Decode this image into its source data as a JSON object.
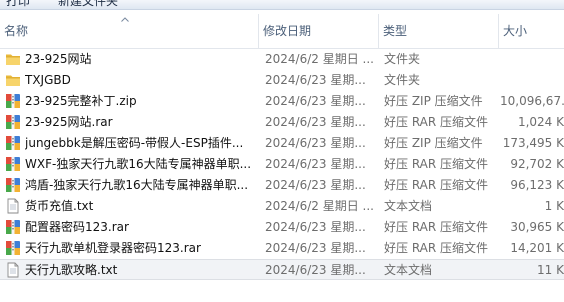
{
  "toolbar": {
    "print_label": "打印",
    "new_folder_label": "新建文件夹"
  },
  "columns": {
    "name": "名称",
    "date": "修改日期",
    "type": "类型",
    "size": "大小"
  },
  "files": [
    {
      "name": "23-925网站",
      "date": "2024/6/2 星期日 ...",
      "type": "文件夹",
      "size": "",
      "icon": "folder-icon"
    },
    {
      "name": "TXJGBD",
      "date": "2024/6/23 星期...",
      "type": "文件夹",
      "size": "",
      "icon": "folder-icon"
    },
    {
      "name": "23-925完整补丁.zip",
      "date": "2024/6/23 星期...",
      "type": "好压 ZIP 压缩文件",
      "size": "10,096,67...",
      "icon": "archive-icon"
    },
    {
      "name": "23-925网站.rar",
      "date": "2024/6/23 星期...",
      "type": "好压 RAR 压缩文件",
      "size": "1,024 K",
      "icon": "archive-icon"
    },
    {
      "name": "jungebbk是解压密码-带假人-ESP插件...",
      "date": "2024/6/23 星期...",
      "type": "好压 ZIP 压缩文件",
      "size": "173,495 K",
      "icon": "archive-icon"
    },
    {
      "name": "WXF-独家天行九歌16大陆专属神器单职...",
      "date": "2024/6/23 星期...",
      "type": "好压 RAR 压缩文件",
      "size": "92,702 K",
      "icon": "archive-icon"
    },
    {
      "name": "鸿盾-独家天行九歌16大陆专属神器单职...",
      "date": "2024/6/23 星期...",
      "type": "好压 RAR 压缩文件",
      "size": "96,123 K",
      "icon": "archive-icon"
    },
    {
      "name": "货币充值.txt",
      "date": "2024/6/2 星期日 ...",
      "type": "文本文档",
      "size": "1 K",
      "icon": "text-file-icon"
    },
    {
      "name": "配置器密码123.rar",
      "date": "2024/6/23 星期...",
      "type": "好压 RAR 压缩文件",
      "size": "30,965 K",
      "icon": "archive-icon"
    },
    {
      "name": "天行九歌单机登录器密码123.rar",
      "date": "2024/6/23 星期...",
      "type": "好压 RAR 压缩文件",
      "size": "14,201 K",
      "icon": "archive-icon"
    },
    {
      "name": "天行九歌攻略.txt",
      "date": "2024/6/23 星期...",
      "type": "文本文档",
      "size": "11 K",
      "icon": "text-file-icon",
      "selected": true
    }
  ]
}
